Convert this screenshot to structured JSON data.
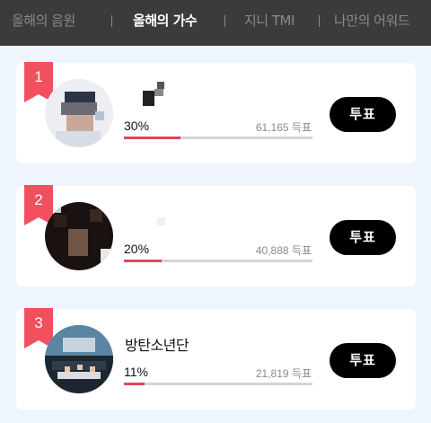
{
  "tabs": [
    {
      "label": "올해의 음원",
      "active": false
    },
    {
      "label": "올해의 가수",
      "active": true
    },
    {
      "label": "지니 TMI",
      "active": false
    },
    {
      "label": "나만의 어워드",
      "active": false
    }
  ],
  "entries": [
    {
      "rank": "1",
      "name": "",
      "percent_label": "30%",
      "percent": 30,
      "votes_label": "61,165 득표",
      "button_label": "투표",
      "avatar": "pixelated-portrait-avatar"
    },
    {
      "rank": "2",
      "name": "",
      "percent_label": "20%",
      "percent": 20,
      "votes_label": "40,888 득표",
      "button_label": "투표",
      "avatar": "pixelated-portrait-avatar"
    },
    {
      "rank": "3",
      "name": "방탄소년단",
      "percent_label": "11%",
      "percent": 11,
      "votes_label": "21,819 득표",
      "button_label": "투표",
      "avatar": "group-photo-avatar"
    }
  ],
  "colors": {
    "ribbon": "#f2505f",
    "progress_fill": "#e0475a",
    "progress_track": "#d4d4d4",
    "button": "#000000",
    "header": "#3b3b3b",
    "page_bg": "#eef5fd"
  }
}
